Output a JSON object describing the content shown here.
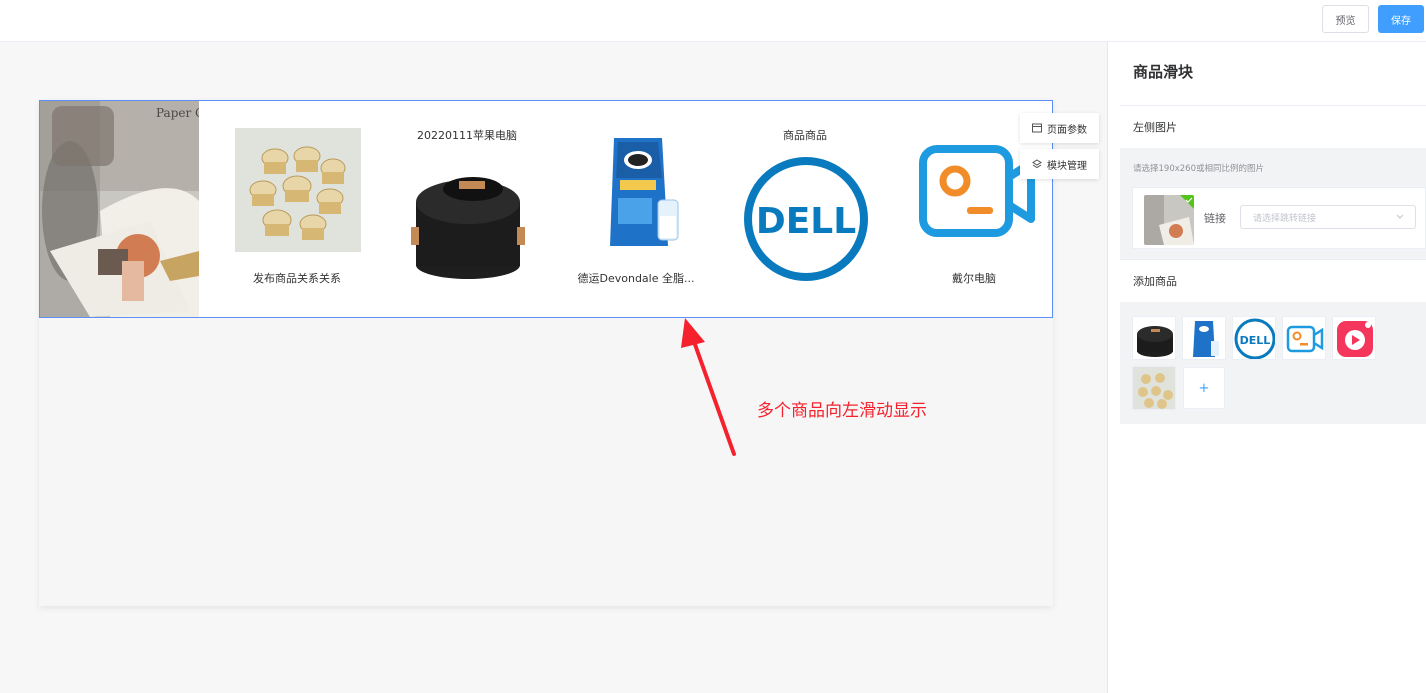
{
  "toolbar": {
    "preview_label": "预览",
    "save_label": "保存"
  },
  "slider": {
    "left_image_text": "Paper C",
    "products": [
      {
        "name": "发布商品关系关系",
        "name_position": "below",
        "image": "ice-cream-cups"
      },
      {
        "name": "20220111苹果电脑",
        "name_position": "above",
        "image": "rice-cooker"
      },
      {
        "name": "德运Devondale 全脂...",
        "name_position": "below",
        "image": "milk-powder"
      },
      {
        "name": "商品商品",
        "name_position": "above",
        "image": "dell-logo"
      },
      {
        "name": "戴尔电脑",
        "name_position": "below",
        "image": "video-camera-icon"
      }
    ]
  },
  "float_menu": {
    "page_params": "页面参数",
    "module_manage": "模块管理"
  },
  "annotation": "多个商品向左滑动显示",
  "panel": {
    "title": "商品滑块",
    "left_image_section": {
      "heading": "左侧图片",
      "hint": "请选择190x260或相同比例的图片",
      "link_label": "链接",
      "link_placeholder": "请选择跳转链接"
    },
    "goods_section": {
      "heading": "添加商品",
      "add_label": "+"
    }
  },
  "colors": {
    "accent": "#409eff",
    "annotation": "#f5222d",
    "slider_border": "#5b8ff9"
  }
}
